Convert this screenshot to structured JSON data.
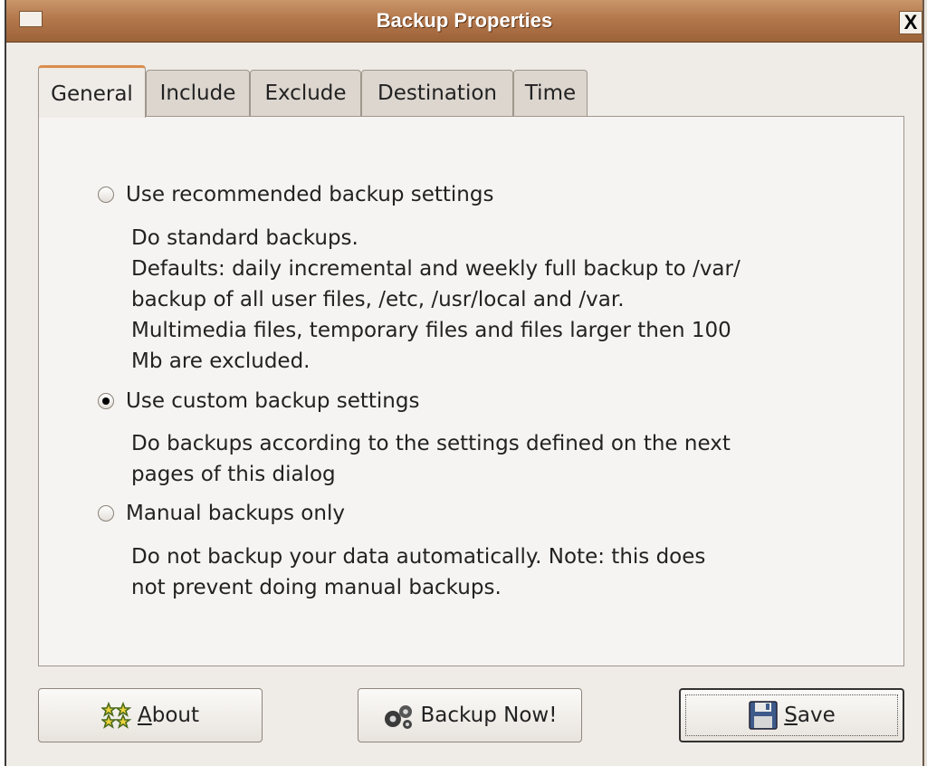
{
  "window": {
    "title": "Backup Properties",
    "close_glyph": "X"
  },
  "tabs": [
    {
      "label": "General",
      "active": true
    },
    {
      "label": "Include",
      "active": false
    },
    {
      "label": "Exclude",
      "active": false
    },
    {
      "label": "Destination",
      "active": false
    },
    {
      "label": "Time",
      "active": false
    }
  ],
  "general": {
    "options": [
      {
        "label": "Use recommended backup settings",
        "checked": false,
        "description": [
          "Do standard backups.",
          "Defaults: daily incremental and weekly full backup to /var/",
          "backup of all user files, /etc, /usr/local and /var.",
          "Multimedia files, temporary files and files larger then 100",
          "Mb are excluded."
        ]
      },
      {
        "label": "Use custom backup settings",
        "checked": true,
        "description": [
          "Do backups according to the settings defined on the next",
          "pages of this dialog"
        ]
      },
      {
        "label": "Manual backups only",
        "checked": false,
        "description": [
          "Do not backup your data automatically. Note: this does",
          "not prevent doing manual backups."
        ]
      }
    ]
  },
  "buttons": {
    "about": {
      "mnemonic": "A",
      "rest": "bout",
      "icon": "about-stars-icon"
    },
    "backup_now": {
      "label": "Backup Now!",
      "icon": "gears-icon"
    },
    "save": {
      "mnemonic": "S",
      "rest": "ave",
      "icon": "floppy-disk-icon"
    }
  },
  "colors": {
    "titlebar": "#b4784c",
    "active_tab_accent": "#d98e4c",
    "dialog_bg": "#efebe7"
  }
}
